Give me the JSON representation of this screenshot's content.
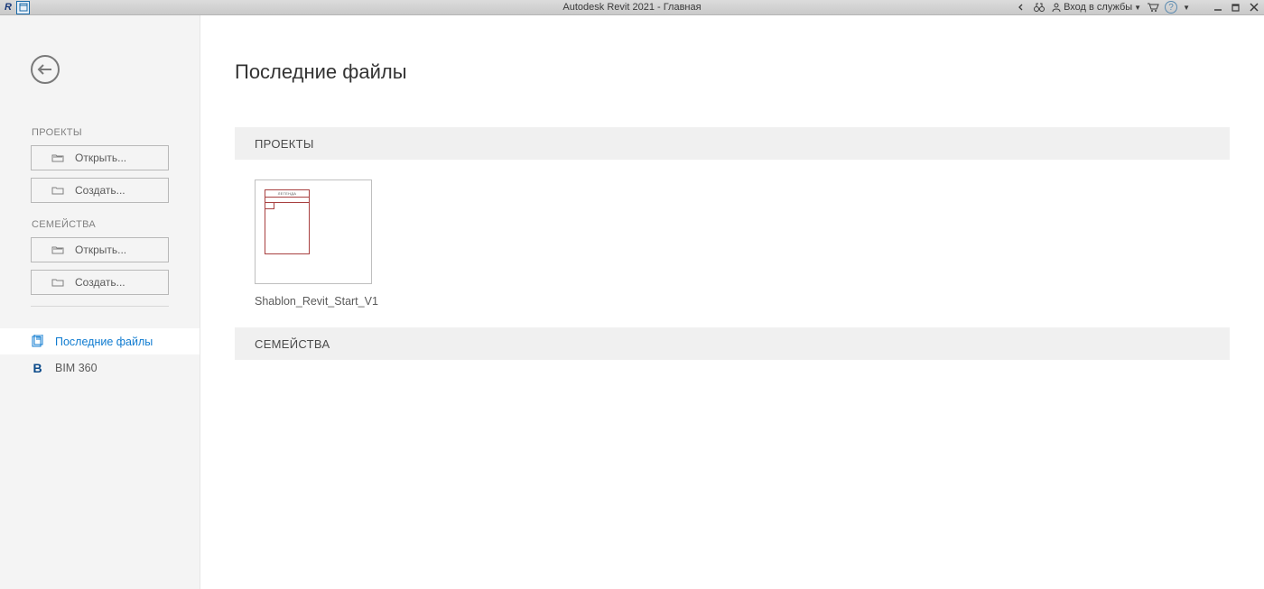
{
  "titlebar": {
    "title": "Autodesk Revit 2021 - Главная",
    "login_label": "Вход в службы"
  },
  "sidebar": {
    "projects_title": "ПРОЕКТЫ",
    "families_title": "СЕМЕЙСТВА",
    "open_label": "Открыть...",
    "create_label": "Создать...",
    "nav_recent": "Последние файлы",
    "nav_bim": "BIM 360"
  },
  "content": {
    "page_title": "Последние файлы",
    "projects_header": "ПРОЕКТЫ",
    "families_header": "СЕМЕЙСТВА",
    "thumb_hdr": "ЛЕГЕНДА",
    "recent_projects": [
      {
        "label": "Shablon_Revit_Start_V1"
      }
    ]
  }
}
